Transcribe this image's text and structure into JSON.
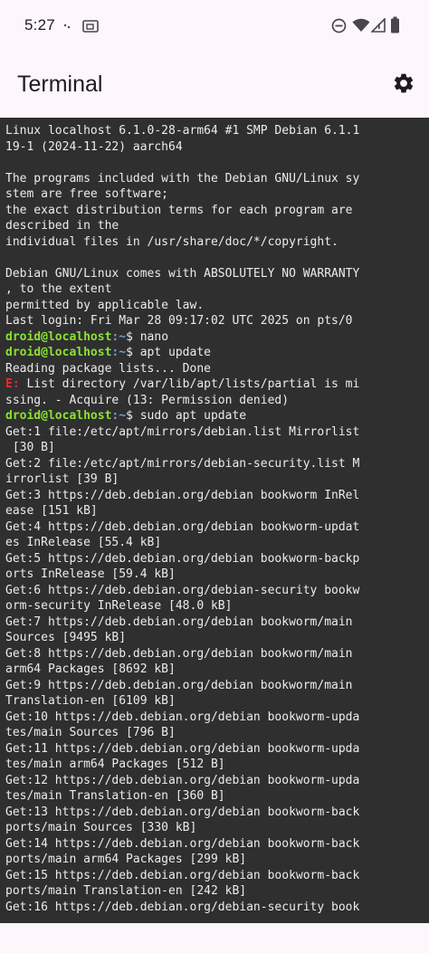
{
  "status_bar": {
    "time": "5:27",
    "icons": [
      "notification-dots-icon",
      "cast-icon",
      "do-not-disturb-icon",
      "wifi-icon",
      "signal-icon",
      "battery-icon"
    ]
  },
  "app_bar": {
    "title": "Terminal",
    "settings_icon": "gear-icon"
  },
  "colors": {
    "terminal_bg": "#2f2f2f",
    "terminal_fg": "#ececec",
    "prompt_user": "#8ae234",
    "prompt_path": "#729fcf",
    "error": "#ef2929",
    "app_bg": "#fdf7fc"
  },
  "terminal": {
    "lines": [
      {
        "type": "text",
        "text": "Linux localhost 6.1.0-28-arm64 #1 SMP Debian 6.1.1"
      },
      {
        "type": "text",
        "text": "19-1 (2024-11-22) aarch64"
      },
      {
        "type": "text",
        "text": ""
      },
      {
        "type": "text",
        "text": "The programs included with the Debian GNU/Linux sy"
      },
      {
        "type": "text",
        "text": "stem are free software;"
      },
      {
        "type": "text",
        "text": "the exact distribution terms for each program are"
      },
      {
        "type": "text",
        "text": "described in the"
      },
      {
        "type": "text",
        "text": "individual files in /usr/share/doc/*/copyright."
      },
      {
        "type": "text",
        "text": ""
      },
      {
        "type": "text",
        "text": "Debian GNU/Linux comes with ABSOLUTELY NO WARRANTY"
      },
      {
        "type": "text",
        "text": ", to the extent"
      },
      {
        "type": "text",
        "text": "permitted by applicable law."
      },
      {
        "type": "text",
        "text": "Last login: Fri Mar 28 09:17:02 UTC 2025 on pts/0"
      },
      {
        "type": "prompt",
        "user": "droid@localhost",
        "path": ":~",
        "cmd": "$ nano"
      },
      {
        "type": "prompt",
        "user": "droid@localhost",
        "path": ":~",
        "cmd": "$ apt update"
      },
      {
        "type": "text",
        "text": "Reading package lists... Done"
      },
      {
        "type": "error",
        "tag": "E:",
        "text": " List directory /var/lib/apt/lists/partial is mi"
      },
      {
        "type": "text",
        "text": "ssing. - Acquire (13: Permission denied)"
      },
      {
        "type": "prompt",
        "user": "droid@localhost",
        "path": ":~",
        "cmd": "$ sudo apt update"
      },
      {
        "type": "text",
        "text": "Get:1 file:/etc/apt/mirrors/debian.list Mirrorlist"
      },
      {
        "type": "text",
        "text": " [30 B]"
      },
      {
        "type": "text",
        "text": "Get:2 file:/etc/apt/mirrors/debian-security.list M"
      },
      {
        "type": "text",
        "text": "irrorlist [39 B]"
      },
      {
        "type": "text",
        "text": "Get:3 https://deb.debian.org/debian bookworm InRel"
      },
      {
        "type": "text",
        "text": "ease [151 kB]"
      },
      {
        "type": "text",
        "text": "Get:4 https://deb.debian.org/debian bookworm-updat"
      },
      {
        "type": "text",
        "text": "es InRelease [55.4 kB]"
      },
      {
        "type": "text",
        "text": "Get:5 https://deb.debian.org/debian bookworm-backp"
      },
      {
        "type": "text",
        "text": "orts InRelease [59.4 kB]"
      },
      {
        "type": "text",
        "text": "Get:6 https://deb.debian.org/debian-security bookw"
      },
      {
        "type": "text",
        "text": "orm-security InRelease [48.0 kB]"
      },
      {
        "type": "text",
        "text": "Get:7 https://deb.debian.org/debian bookworm/main"
      },
      {
        "type": "text",
        "text": "Sources [9495 kB]"
      },
      {
        "type": "text",
        "text": "Get:8 https://deb.debian.org/debian bookworm/main"
      },
      {
        "type": "text",
        "text": "arm64 Packages [8692 kB]"
      },
      {
        "type": "text",
        "text": "Get:9 https://deb.debian.org/debian bookworm/main"
      },
      {
        "type": "text",
        "text": "Translation-en [6109 kB]"
      },
      {
        "type": "text",
        "text": "Get:10 https://deb.debian.org/debian bookworm-upda"
      },
      {
        "type": "text",
        "text": "tes/main Sources [796 B]"
      },
      {
        "type": "text",
        "text": "Get:11 https://deb.debian.org/debian bookworm-upda"
      },
      {
        "type": "text",
        "text": "tes/main arm64 Packages [512 B]"
      },
      {
        "type": "text",
        "text": "Get:12 https://deb.debian.org/debian bookworm-upda"
      },
      {
        "type": "text",
        "text": "tes/main Translation-en [360 B]"
      },
      {
        "type": "text",
        "text": "Get:13 https://deb.debian.org/debian bookworm-back"
      },
      {
        "type": "text",
        "text": "ports/main Sources [330 kB]"
      },
      {
        "type": "text",
        "text": "Get:14 https://deb.debian.org/debian bookworm-back"
      },
      {
        "type": "text",
        "text": "ports/main arm64 Packages [299 kB]"
      },
      {
        "type": "text",
        "text": "Get:15 https://deb.debian.org/debian bookworm-back"
      },
      {
        "type": "text",
        "text": "ports/main Translation-en [242 kB]"
      },
      {
        "type": "text",
        "text": "Get:16 https://deb.debian.org/debian-security book"
      }
    ]
  }
}
